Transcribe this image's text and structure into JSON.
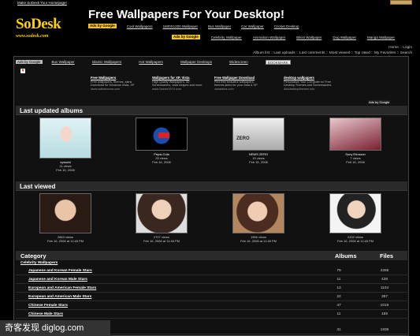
{
  "topbar": {
    "link": "Make SoDesk Your Homepage!"
  },
  "logo": {
    "main": "SoDesk",
    "url": "www.sodesk.com"
  },
  "site_title": "Free Wallpapers For Your Desktop!",
  "nav1": {
    "ads_label": "Ads by Google",
    "links": [
      "Cool Wallpapers",
      "1600X1200 Wallpaper",
      "Bus Wallpaper",
      "Car Wallpaper",
      "Cricket Desktop"
    ]
  },
  "nav2": {
    "ads_label": "Ads by Google",
    "links": [
      "Celebrity Wallpaper",
      "Animation Wallpaper",
      "Bikini Wallpaper",
      "Dog Wallpaper",
      "Manga Wallpaper"
    ]
  },
  "album_links": {
    "row1": "Home :: Login",
    "row2": "Album list :: Last uploads :: Last comments :: Most viewed :: Top rated :: My Favorites :: Search"
  },
  "adbar": {
    "ads_label": "Ads by Google",
    "links": [
      "Bus Wallpaper",
      "Islamic Wallpapers",
      "Hot Wallpapers",
      "Wallpaper Desktops",
      "Widescreen"
    ],
    "chip": "BOOKMARK"
  },
  "text_ads": [
    {
      "title": "Free Wallpapers",
      "body": "Free wallpapers, themes, skins Download for Windows Vista, XP",
      "url": "www.softonicnow.com"
    },
    {
      "title": "Wallpapers for XP, Vista",
      "body": "High Quality Wallpapers, 3D Screensavers, vista shapes and more",
      "url": "www.Sarver1974.com"
    },
    {
      "title": "Free Wallpaper Download",
      "body": "Find free beautiful wallpapers, themes,skins for your vista & XP",
      "url": "vistaskins.com"
    },
    {
      "title": "desktop wallpapers",
      "body": "Personalize Your Computer w/ Free Desktop Themes and Screensavers.",
      "url": "All4desktopthemes.info"
    }
  ],
  "ads_by": "Ads by Google",
  "sections": {
    "last_updated": "Last updated albums",
    "last_viewed": "Last viewed"
  },
  "updated_albums": [
    {
      "title": "cyworld",
      "views": "11 views",
      "date": "Feb 16, 2008"
    },
    {
      "title": "Pepsi-Cola",
      "views": "25 views",
      "date": "Feb 16, 2008"
    },
    {
      "title": "NEWS ZERO",
      "views": "15 views",
      "date": "Feb 16, 2008"
    },
    {
      "title": "Sony Ericsson",
      "views": "7 views",
      "date": "Feb 16, 2008"
    }
  ],
  "viewed_albums": [
    {
      "views": "2863 views",
      "date": "Feb 16, 2008 at 11:48 PM"
    },
    {
      "views": "2707 views",
      "date": "Feb 16, 2008 at 11:48 PM"
    },
    {
      "views": "1966 views",
      "date": "Feb 16, 2008 at 11:48 PM"
    },
    {
      "views": "2432 views",
      "date": "Feb 16, 2008 at 11:48 PM"
    }
  ],
  "category": {
    "header": "Category",
    "albums_col": "Albums",
    "files_col": "Files",
    "parent": "Celebrity Wallpapers",
    "rows": [
      {
        "name": "Japanese and Korean Female Stars",
        "albums": "79",
        "files": "4265"
      },
      {
        "name": "Japanese and Korean Male Stars",
        "albums": "11",
        "files": "428"
      },
      {
        "name": "European and American Female Stars",
        "albums": "13",
        "files": "1104"
      },
      {
        "name": "European and American Male Stars",
        "albums": "22",
        "files": "397"
      },
      {
        "name": "Chinese Female Stars",
        "albums": "47",
        "files": "1019"
      },
      {
        "name": "Chinese Male Stars",
        "albums": "11",
        "files": "169"
      },
      {
        "name": "",
        "albums": "31",
        "files": "1836"
      }
    ]
  },
  "watermark": "奇客发现 diglog.com"
}
